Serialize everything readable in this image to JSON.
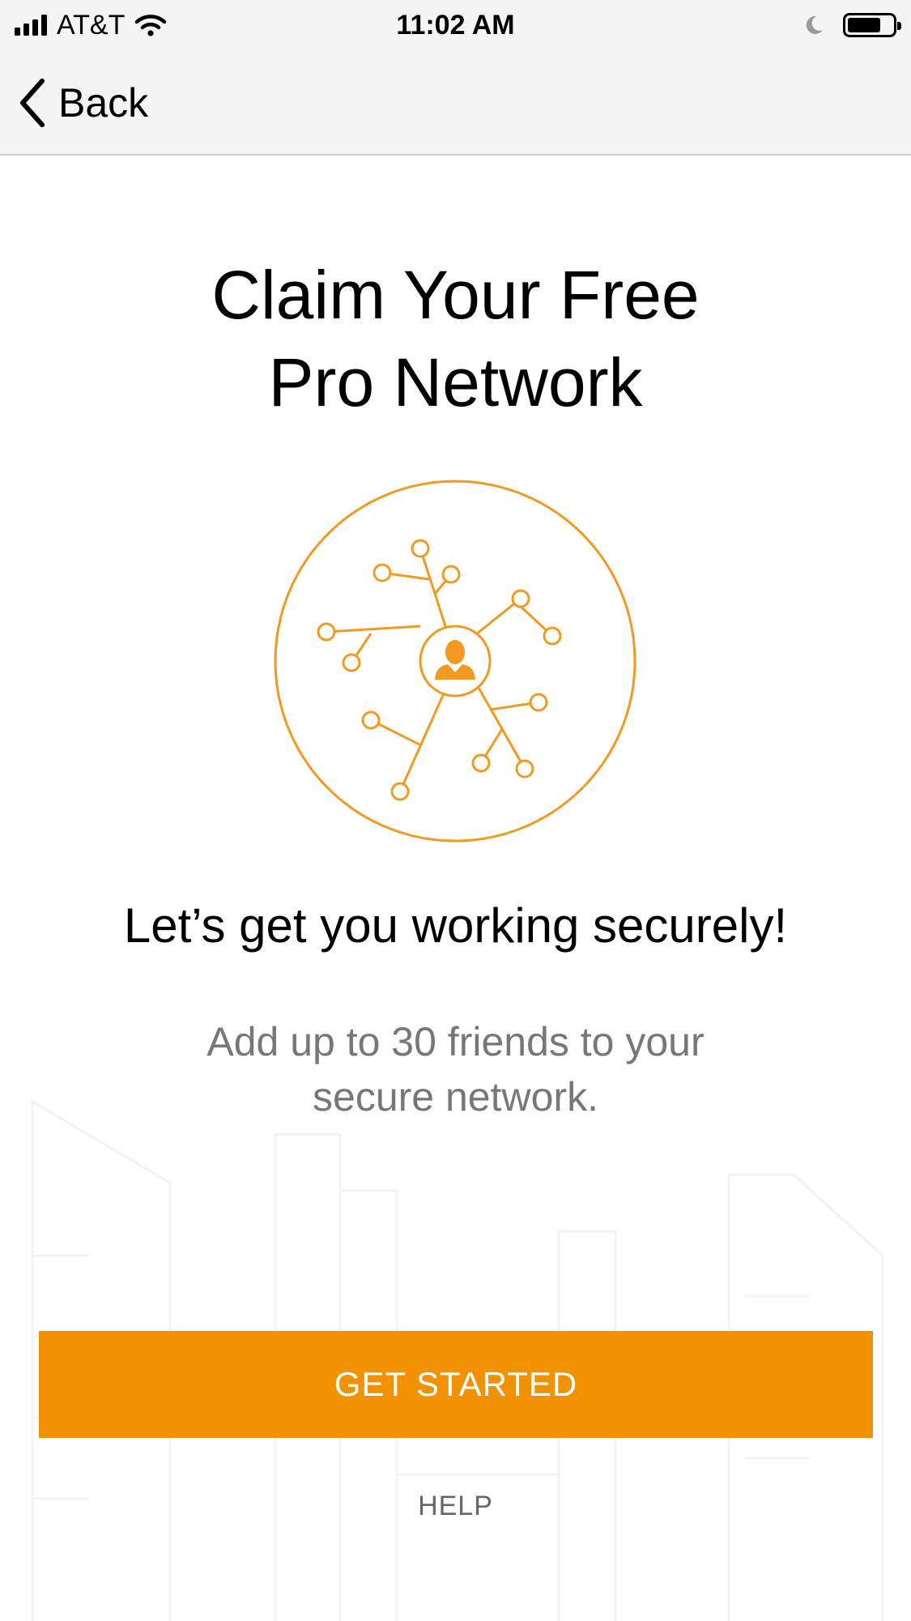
{
  "status_bar": {
    "carrier": "AT&T",
    "time": "11:02 AM"
  },
  "nav": {
    "back_label": "Back"
  },
  "main": {
    "title_line1": "Claim Your Free",
    "title_line2": "Pro Network",
    "headline": "Let’s get you working securely!",
    "subtext_line1": "Add up to 30 friends to your",
    "subtext_line2": "secure network."
  },
  "actions": {
    "primary_label": "GET STARTED",
    "help_label": "HELP"
  },
  "icons": {
    "back": "chevron-left-icon",
    "network": "network-icon",
    "person": "person-icon",
    "signal": "cellular-signal-icon",
    "wifi": "wifi-icon",
    "moon": "do-not-disturb-moon-icon",
    "battery": "battery-icon"
  },
  "colors": {
    "accent": "#f29200",
    "title": "#000000",
    "subtext": "#777777",
    "nav_background": "#f4f4f4"
  }
}
